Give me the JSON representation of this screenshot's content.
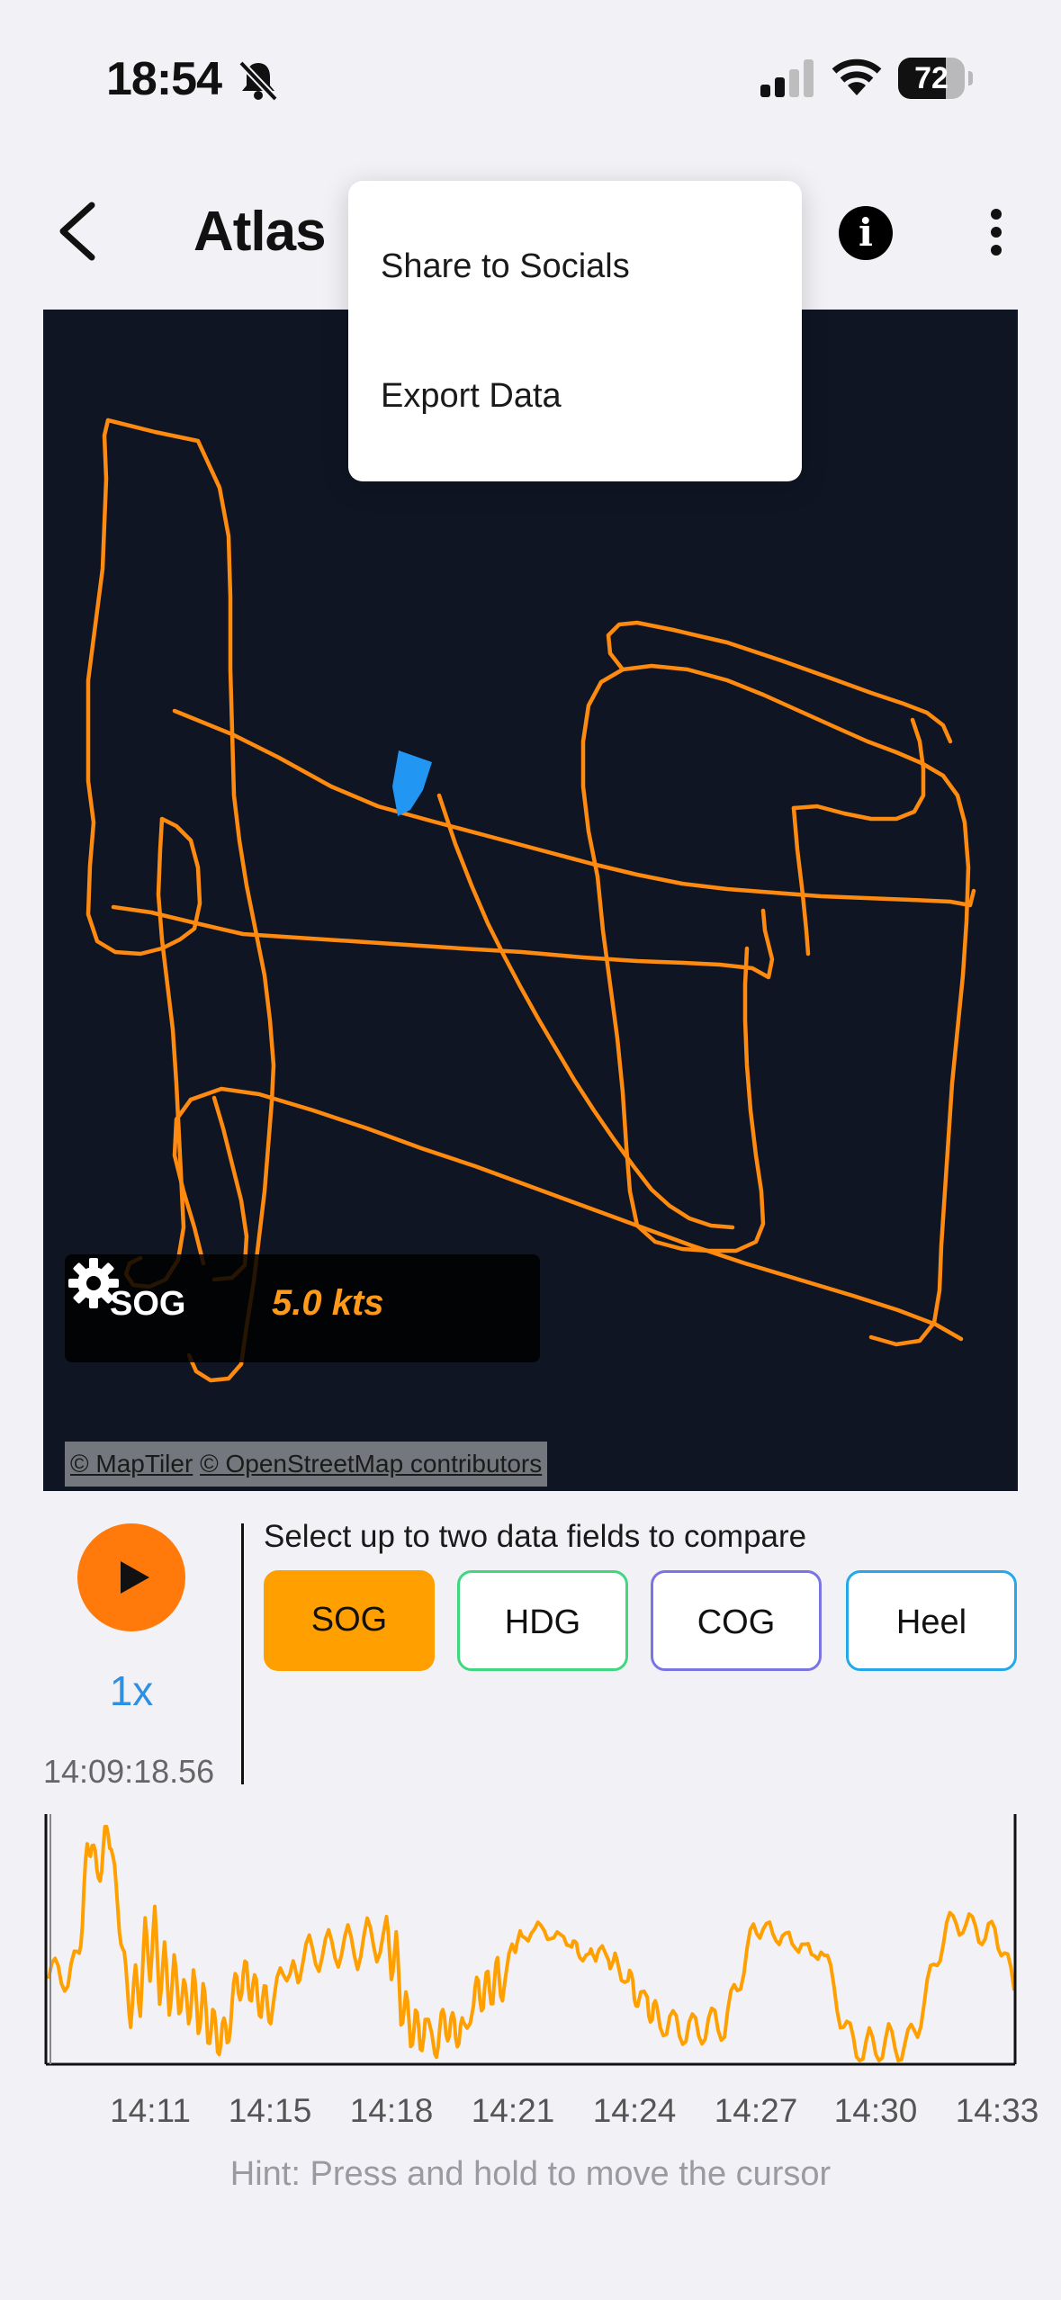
{
  "status": {
    "time": "18:54",
    "battery": "72",
    "battery_level": 0.72
  },
  "header": {
    "title": "Atlas"
  },
  "menu": {
    "items": [
      "Share to Socials",
      "Export Data"
    ]
  },
  "map": {
    "overlay": {
      "metric": "SOG",
      "value": "5.0 kts"
    },
    "attribution": {
      "maptiler": "© MapTiler",
      "osm": "© OpenStreetMap contributors"
    }
  },
  "controls": {
    "speed": "1x",
    "cursor_time": "14:09:18.56",
    "compare_hint": "Select up to two data fields to compare",
    "fields": [
      {
        "label": "SOG",
        "color": "#ffa000",
        "selected": true
      },
      {
        "label": "HDG",
        "color": "#40d77f",
        "selected": false
      },
      {
        "label": "COG",
        "color": "#7b74e3",
        "selected": false
      },
      {
        "label": "Heel",
        "color": "#23a9ea",
        "selected": false
      }
    ]
  },
  "chart_data": {
    "type": "line",
    "series": [
      {
        "name": "SOG",
        "color": "#ffa000"
      }
    ],
    "x_ticks": [
      "14:11",
      "14:15",
      "14:18",
      "14:21",
      "14:24",
      "14:27",
      "14:30",
      "14:33"
    ],
    "hint": "Hint: Press and hold to move the cursor"
  },
  "colors": {
    "track": "#ff8a10",
    "boat": "#2196f3",
    "map_bg": "#0f1523",
    "accent": "#ff7a0a"
  }
}
